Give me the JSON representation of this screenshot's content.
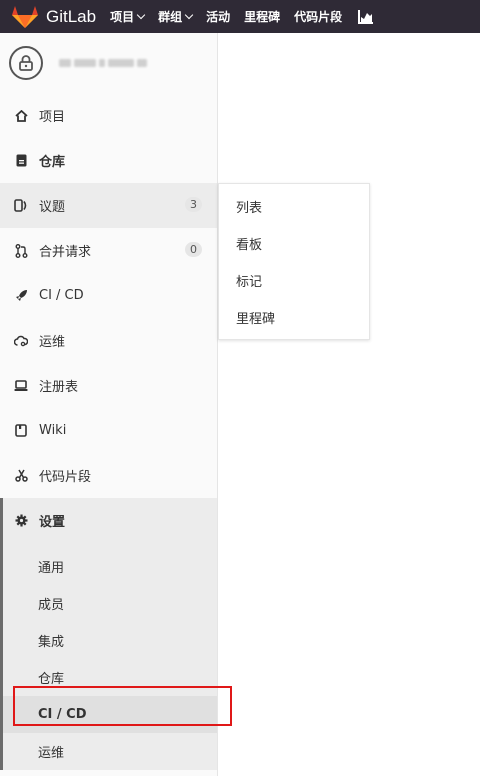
{
  "topbar": {
    "brand": "GitLab",
    "nav": [
      {
        "label": "项目",
        "has_caret": true
      },
      {
        "label": "群组",
        "has_caret": true
      },
      {
        "label": "活动",
        "has_caret": false
      },
      {
        "label": "里程碑",
        "has_caret": false
      },
      {
        "label": "代码片段",
        "has_caret": false
      }
    ],
    "chart_icon": "chart-icon"
  },
  "sidebar": {
    "items": [
      {
        "label": "项目",
        "icon": "home-icon"
      },
      {
        "label": "仓库",
        "icon": "doc-icon"
      },
      {
        "label": "议题",
        "icon": "issues-icon",
        "badge": "3"
      },
      {
        "label": "合并请求",
        "icon": "merge-icon",
        "badge": "0"
      },
      {
        "label": "CI / CD",
        "icon": "rocket-icon"
      },
      {
        "label": "运维",
        "icon": "cloud-icon"
      },
      {
        "label": "注册表",
        "icon": "registry-icon"
      },
      {
        "label": "Wiki",
        "icon": "book-icon"
      },
      {
        "label": "代码片段",
        "icon": "scissors-icon"
      }
    ],
    "settings": {
      "label": "设置",
      "icon": "gear-icon",
      "subitems": [
        "通用",
        "成员",
        "集成",
        "仓库",
        "CI / CD",
        "运维"
      ],
      "active_subitem": "CI / CD"
    }
  },
  "flyout": {
    "items": [
      "列表",
      "看板",
      "标记",
      "里程碑"
    ]
  },
  "colors": {
    "topbar": "#2f2a36",
    "highlight": "#e01818",
    "logo": "#fc6d26"
  }
}
